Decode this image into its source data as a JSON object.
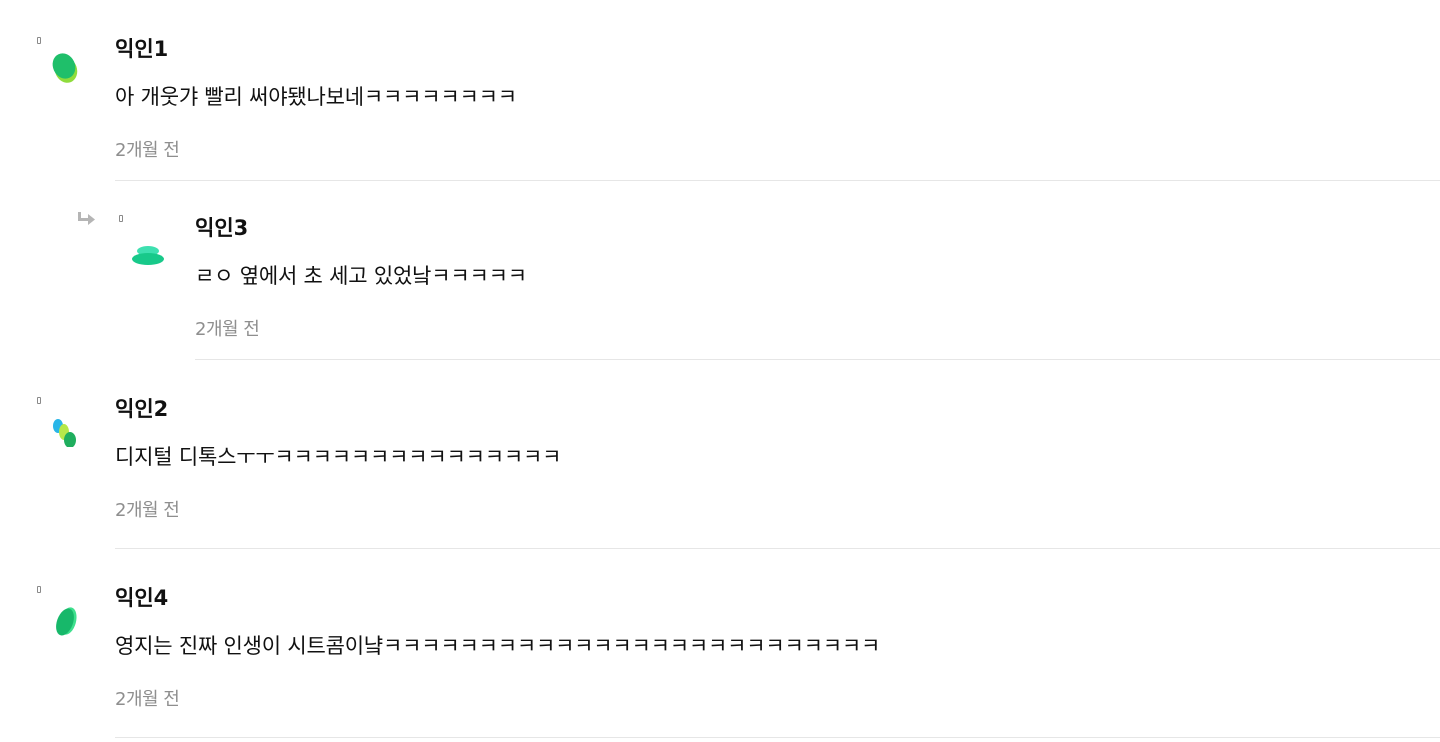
{
  "comments": [
    {
      "author": "익인1",
      "text": "아 개웃갸 빨리 써야됐나보네ㅋㅋㅋㅋㅋㅋㅋㅋ",
      "time": "2개월 전",
      "avatar_colors": [
        "#1fbf6a",
        "#8fdc3c"
      ]
    },
    {
      "author": "익인3",
      "text": "ㄹㅇ 옆에서 초 세고 있었낰ㅋㅋㅋㅋㅋ",
      "time": "2개월 전",
      "avatar_colors": [
        "#18c98a",
        "#3ee0b0"
      ]
    },
    {
      "author": "익인2",
      "text": "디지털 디톡스ㅜㅜㅋㅋㅋㅋㅋㅋㅋㅋㅋㅋㅋㅋㅋㅋㅋ",
      "time": "2개월 전",
      "avatar_colors": [
        "#29b6e8",
        "#b6e84a",
        "#1fae5e"
      ]
    },
    {
      "author": "익인4",
      "text": "영지는 진짜 인생이 시트콤이냨ㅋㅋㅋㅋㅋㅋㅋㅋㅋㅋㅋㅋㅋㅋㅋㅋㅋㅋㅋㅋㅋㅋㅋㅋㅋㅋ",
      "time": "2개월 전",
      "avatar_colors": [
        "#17b86a",
        "#3fe08e"
      ]
    }
  ]
}
